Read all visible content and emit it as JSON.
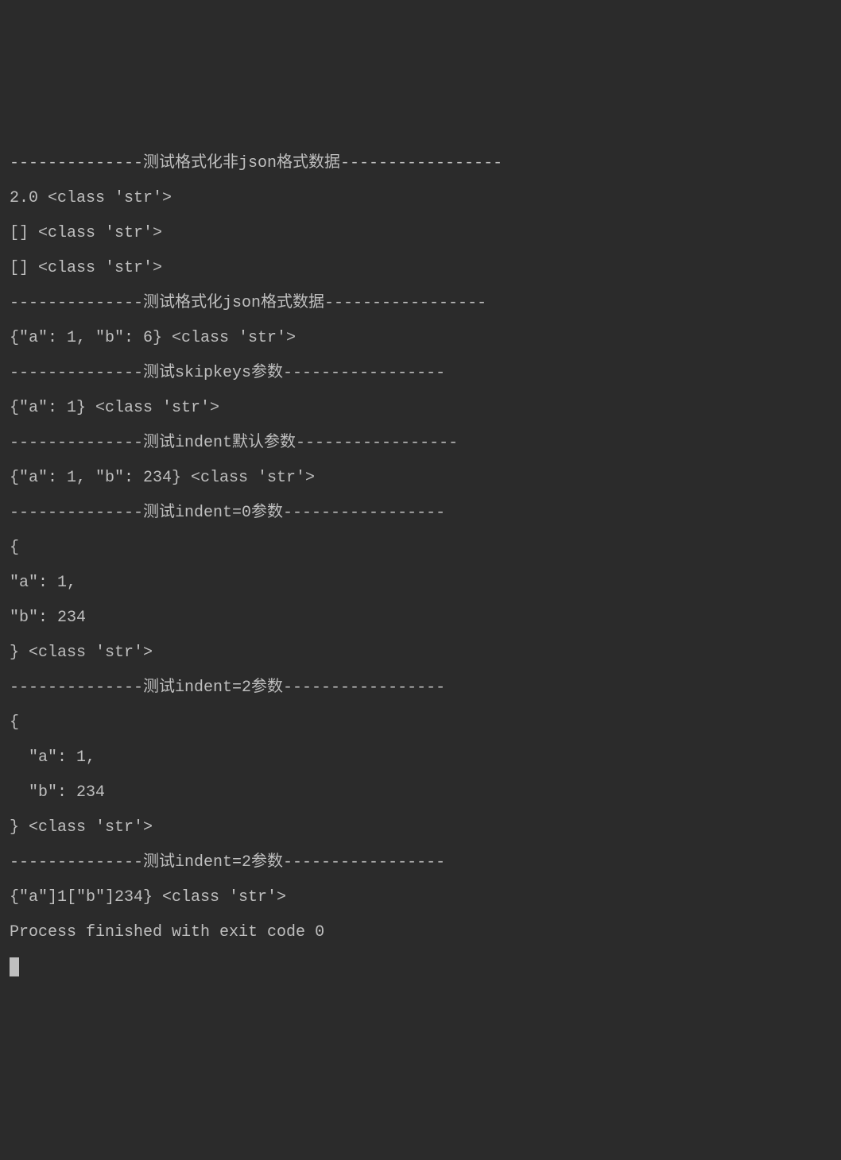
{
  "terminal": {
    "lines": [
      "--------------测试格式化非json格式数据-----------------",
      "2.0 <class 'str'>",
      "[] <class 'str'>",
      "[] <class 'str'>",
      "--------------测试格式化json格式数据-----------------",
      "{\"a\": 1, \"b\": 6} <class 'str'>",
      "--------------测试skipkeys参数-----------------",
      "{\"a\": 1} <class 'str'>",
      "--------------测试indent默认参数-----------------",
      "{\"a\": 1, \"b\": 234} <class 'str'>",
      "--------------测试indent=0参数-----------------",
      "{",
      "\"a\": 1,",
      "\"b\": 234",
      "} <class 'str'>",
      "--------------测试indent=2参数-----------------",
      "{",
      "  \"a\": 1,",
      "  \"b\": 234",
      "} <class 'str'>",
      "--------------测试indent=2参数-----------------",
      "{\"a\"]1[\"b\"]234} <class 'str'>",
      "",
      "Process finished with exit code 0"
    ]
  }
}
